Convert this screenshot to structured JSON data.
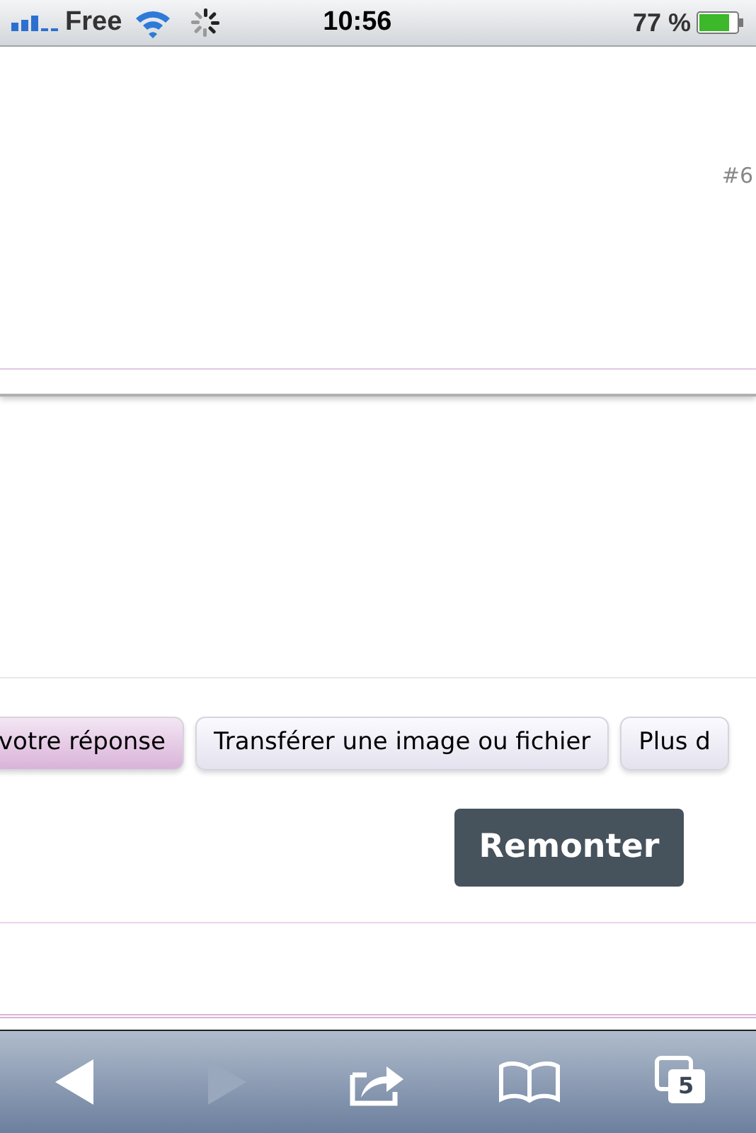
{
  "status_bar": {
    "carrier": "Free",
    "time": "10:56",
    "battery": "77 %"
  },
  "post": {
    "number": "#6"
  },
  "actions": [
    {
      "label": "votre réponse",
      "kind": "primary"
    },
    {
      "label": "Transférer une image ou fichier",
      "kind": "secondary"
    },
    {
      "label": "Plus d",
      "kind": "secondary"
    }
  ],
  "back_to_top": {
    "label": "Remonter"
  },
  "toolbar": {
    "back": {
      "disabled": false
    },
    "forward": {
      "disabled": true
    },
    "tabs_count": "5"
  }
}
